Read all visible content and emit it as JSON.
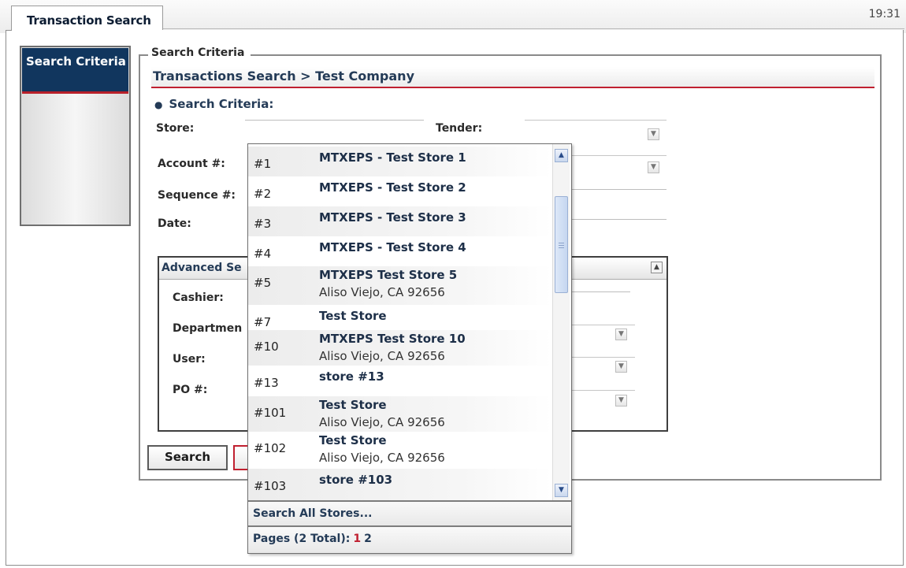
{
  "app": {
    "tab_label": "Transaction Search",
    "clock": "19:31"
  },
  "sidebar": {
    "items": [
      {
        "label": "Search Criteria"
      }
    ]
  },
  "criteria": {
    "legend": "Search Criteria",
    "breadcrumb": "Transactions Search > Test Company",
    "section_heading": "Search Criteria:",
    "labels": {
      "store": "Store:",
      "tender": "Tender:",
      "account": "Account #:",
      "sequence": "Sequence #:",
      "date": "Date:"
    }
  },
  "advanced": {
    "header": "Advanced Se",
    "labels": {
      "cashier": "Cashier:",
      "department": "Departmen",
      "user": "User:",
      "po": "PO #:"
    }
  },
  "buttons": {
    "search": "Search"
  },
  "store_dropdown": {
    "stores": [
      {
        "number": "#1",
        "name": "MTXEPS - Test Store 1",
        "address": ""
      },
      {
        "number": "#2",
        "name": "MTXEPS - Test Store 2",
        "address": ""
      },
      {
        "number": "#3",
        "name": "MTXEPS - Test Store 3",
        "address": ""
      },
      {
        "number": "#4",
        "name": "MTXEPS - Test Store 4",
        "address": ""
      },
      {
        "number": "#5",
        "name": "MTXEPS Test Store 5",
        "address": "Aliso Viejo, CA 92656"
      },
      {
        "number": "#7",
        "name": "Test Store",
        "address": ""
      },
      {
        "number": "#10",
        "name": "MTXEPS Test Store 10",
        "address": "Aliso Viejo, CA 92656"
      },
      {
        "number": "#13",
        "name": "store #13",
        "address": ""
      },
      {
        "number": "#101",
        "name": "Test Store",
        "address": "Aliso Viejo, CA 92656"
      },
      {
        "number": "#102",
        "name": "Test Store",
        "address": "Aliso Viejo, CA 92656"
      },
      {
        "number": "#103",
        "name": "store #103",
        "address": ""
      }
    ],
    "search_all_label": "Search All Stores...",
    "pages_label": "Pages (2 Total):",
    "pages": [
      "1",
      "2"
    ],
    "current_page": "1"
  },
  "colors": {
    "nav_active": "#11365e",
    "accent_red": "#c02030"
  },
  "icons": {
    "dropdown": "chevron-down-icon",
    "collapse": "chevron-up-icon",
    "scroll_up": "scroll-up-icon",
    "scroll_down": "scroll-down-icon"
  }
}
